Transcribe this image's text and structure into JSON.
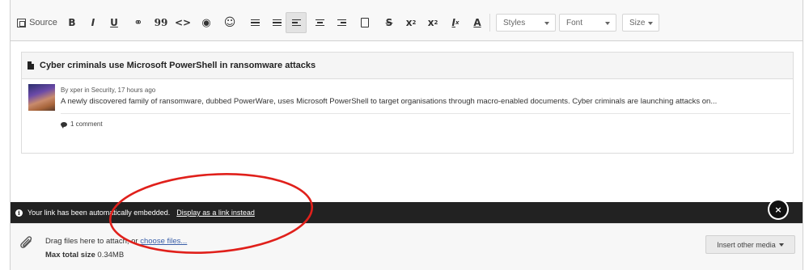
{
  "toolbar": {
    "source_label": "Source",
    "bold": "B",
    "italic": "I",
    "underline": "U",
    "link": "⚭",
    "quote": "99",
    "code": "<>",
    "preview": "◉",
    "smiley": "☺",
    "bulleted": "☷",
    "numbered": "☷",
    "superscript": "x",
    "superscript_mark": "2",
    "subscript": "x",
    "subscript_mark": "2",
    "remove_format": "I",
    "remove_format_mark": "x",
    "strike": "S",
    "text_color": "A",
    "styles": "Styles",
    "font": "Font",
    "size": "Size"
  },
  "embed": {
    "title": "Cyber criminals use Microsoft PowerShell in ransomware attacks",
    "byline": "By xper in Security, 17 hours ago",
    "snippet": "A newly discovered family of ransomware, dubbed PowerWare, uses Microsoft PowerShell to target organisations through macro-enabled documents. Cyber criminals are launching attacks on...",
    "comments": "1 comment"
  },
  "notice": {
    "message": "Your link has been automatically embedded.",
    "link": "Display as a link instead",
    "close": "×"
  },
  "attachments": {
    "drag_text": "Drag files here to attach, or ",
    "choose_link": "choose files...",
    "max_label": "Max total size",
    "max_value": "0.34MB",
    "insert_button": "Insert other media"
  },
  "colors": {
    "notice_bg": "#222222",
    "annotation": "#e0201b",
    "link": "#3a5fa8"
  }
}
